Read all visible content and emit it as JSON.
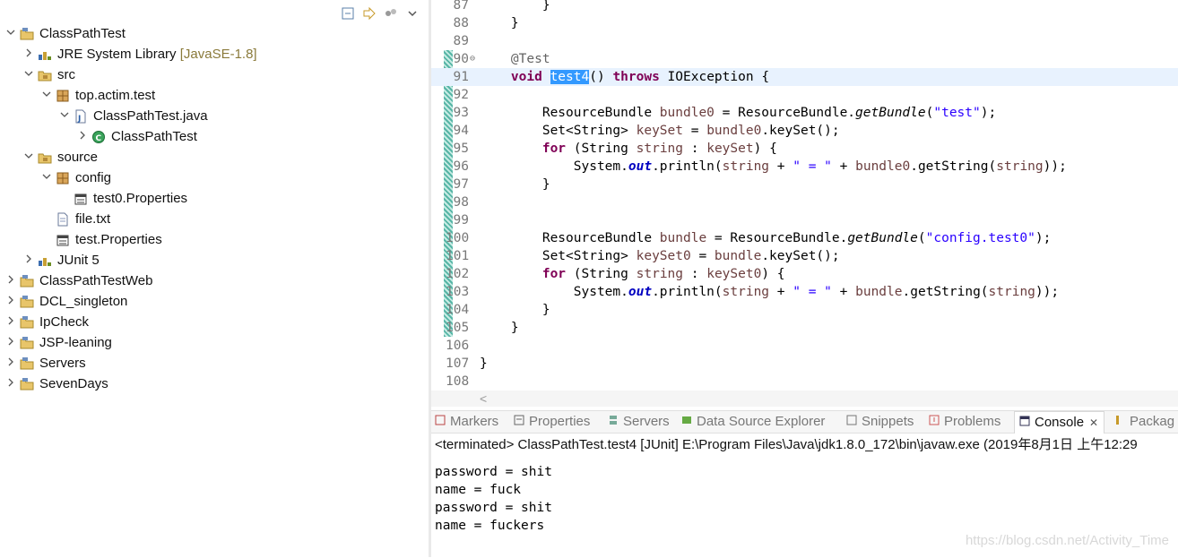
{
  "explorer": {
    "toolbar_icons": [
      "collapse-all-icon",
      "link-with-editor-icon",
      "view-menu-icon",
      "view-menu-chevron-icon"
    ],
    "tree": [
      {
        "label": "ClassPathTest",
        "decor": "",
        "icon": "project-icon",
        "expanded": true
      },
      {
        "label": "JRE System Library",
        "decor": "[JavaSE-1.8]",
        "icon": "library-icon",
        "expanded": false
      },
      {
        "label": "src",
        "decor": "",
        "icon": "source-folder-icon",
        "expanded": true
      },
      {
        "label": "top.actim.test",
        "decor": "",
        "icon": "package-icon",
        "expanded": true
      },
      {
        "label": "ClassPathTest.java",
        "decor": "",
        "icon": "java-file-icon",
        "expanded": true
      },
      {
        "label": "ClassPathTest",
        "decor": "",
        "icon": "class-icon",
        "expanded": false
      },
      {
        "label": "source",
        "decor": "",
        "icon": "source-folder-icon",
        "expanded": true
      },
      {
        "label": "config",
        "decor": "",
        "icon": "package-icon",
        "expanded": true
      },
      {
        "label": "test0.Properties",
        "decor": "",
        "icon": "properties-file-icon",
        "expanded": null
      },
      {
        "label": "file.txt",
        "decor": "",
        "icon": "text-file-icon",
        "expanded": null
      },
      {
        "label": "test.Properties",
        "decor": "",
        "icon": "properties-file-icon",
        "expanded": null
      },
      {
        "label": "JUnit 5",
        "decor": "",
        "icon": "library-icon",
        "expanded": false
      },
      {
        "label": "ClassPathTestWeb",
        "decor": "",
        "icon": "project-icon",
        "expanded": false
      },
      {
        "label": "DCL_singleton",
        "decor": "",
        "icon": "project-icon",
        "expanded": false
      },
      {
        "label": "IpCheck",
        "decor": "",
        "icon": "project-icon",
        "expanded": false
      },
      {
        "label": "JSP-leaning",
        "decor": "",
        "icon": "project-icon",
        "expanded": false
      },
      {
        "label": "Servers",
        "decor": "",
        "icon": "project-icon",
        "expanded": false
      },
      {
        "label": "SevenDays",
        "decor": "",
        "icon": "project-icon",
        "expanded": false
      }
    ]
  },
  "editor": {
    "lines": [
      {
        "no": "87",
        "indent": "        ",
        "parts": [
          {
            "t": "}",
            "c": ""
          }
        ]
      },
      {
        "no": "88",
        "indent": "    ",
        "parts": [
          {
            "t": "}",
            "c": ""
          }
        ]
      },
      {
        "no": "89",
        "indent": "",
        "parts": []
      },
      {
        "no": "90",
        "indent": "    ",
        "fold": "⊖",
        "parts": [
          {
            "t": "@Test",
            "c": "ann"
          }
        ]
      },
      {
        "no": "91",
        "indent": "    ",
        "parts": [
          {
            "t": "void",
            "c": "kw"
          },
          {
            "t": " ",
            "c": ""
          },
          {
            "t": "test4",
            "c": "sel"
          },
          {
            "t": "() ",
            "c": ""
          },
          {
            "t": "throws",
            "c": "kw"
          },
          {
            "t": " IOException {",
            "c": ""
          }
        ]
      },
      {
        "no": "92",
        "indent": "",
        "parts": []
      },
      {
        "no": "93",
        "indent": "        ",
        "parts": [
          {
            "t": "ResourceBundle ",
            "c": ""
          },
          {
            "t": "bundle0",
            "c": "var"
          },
          {
            "t": " = ResourceBundle.",
            "c": ""
          },
          {
            "t": "getBundle",
            "c": "it"
          },
          {
            "t": "(",
            "c": ""
          },
          {
            "t": "\"test\"",
            "c": "str"
          },
          {
            "t": ");",
            "c": ""
          }
        ]
      },
      {
        "no": "94",
        "indent": "        ",
        "parts": [
          {
            "t": "Set<String> ",
            "c": ""
          },
          {
            "t": "keySet",
            "c": "var"
          },
          {
            "t": " = ",
            "c": ""
          },
          {
            "t": "bundle0",
            "c": "var"
          },
          {
            "t": ".keySet();",
            "c": ""
          }
        ]
      },
      {
        "no": "95",
        "indent": "        ",
        "parts": [
          {
            "t": "for",
            "c": "kw"
          },
          {
            "t": " (String ",
            "c": ""
          },
          {
            "t": "string",
            "c": "var"
          },
          {
            "t": " : ",
            "c": ""
          },
          {
            "t": "keySet",
            "c": "var"
          },
          {
            "t": ") {",
            "c": ""
          }
        ]
      },
      {
        "no": "96",
        "indent": "            ",
        "parts": [
          {
            "t": "System.",
            "c": ""
          },
          {
            "t": "out",
            "c": "fld"
          },
          {
            "t": ".println(",
            "c": ""
          },
          {
            "t": "string",
            "c": "var"
          },
          {
            "t": " + ",
            "c": ""
          },
          {
            "t": "\" = \"",
            "c": "str"
          },
          {
            "t": " + ",
            "c": ""
          },
          {
            "t": "bundle0",
            "c": "var"
          },
          {
            "t": ".getString(",
            "c": ""
          },
          {
            "t": "string",
            "c": "var"
          },
          {
            "t": "));",
            "c": ""
          }
        ]
      },
      {
        "no": "97",
        "indent": "        ",
        "parts": [
          {
            "t": "}",
            "c": ""
          }
        ]
      },
      {
        "no": "98",
        "indent": "",
        "parts": []
      },
      {
        "no": "99",
        "indent": "",
        "parts": []
      },
      {
        "no": "100",
        "indent": "        ",
        "parts": [
          {
            "t": "ResourceBundle ",
            "c": ""
          },
          {
            "t": "bundle",
            "c": "var"
          },
          {
            "t": " = ResourceBundle.",
            "c": ""
          },
          {
            "t": "getBundle",
            "c": "it"
          },
          {
            "t": "(",
            "c": ""
          },
          {
            "t": "\"config.test0\"",
            "c": "str"
          },
          {
            "t": ");",
            "c": ""
          }
        ]
      },
      {
        "no": "101",
        "indent": "        ",
        "parts": [
          {
            "t": "Set<String> ",
            "c": ""
          },
          {
            "t": "keySet0",
            "c": "var"
          },
          {
            "t": " = ",
            "c": ""
          },
          {
            "t": "bundle",
            "c": "var"
          },
          {
            "t": ".keySet();",
            "c": ""
          }
        ]
      },
      {
        "no": "102",
        "indent": "        ",
        "parts": [
          {
            "t": "for",
            "c": "kw"
          },
          {
            "t": " (String ",
            "c": ""
          },
          {
            "t": "string",
            "c": "var"
          },
          {
            "t": " : ",
            "c": ""
          },
          {
            "t": "keySet0",
            "c": "var"
          },
          {
            "t": ") {",
            "c": ""
          }
        ]
      },
      {
        "no": "103",
        "indent": "            ",
        "parts": [
          {
            "t": "System.",
            "c": ""
          },
          {
            "t": "out",
            "c": "fld"
          },
          {
            "t": ".println(",
            "c": ""
          },
          {
            "t": "string",
            "c": "var"
          },
          {
            "t": " + ",
            "c": ""
          },
          {
            "t": "\" = \"",
            "c": "str"
          },
          {
            "t": " + ",
            "c": ""
          },
          {
            "t": "bundle",
            "c": "var"
          },
          {
            "t": ".getString(",
            "c": ""
          },
          {
            "t": "string",
            "c": "var"
          },
          {
            "t": "));",
            "c": ""
          }
        ]
      },
      {
        "no": "104",
        "indent": "        ",
        "parts": [
          {
            "t": "}",
            "c": ""
          }
        ]
      },
      {
        "no": "105",
        "indent": "    ",
        "parts": [
          {
            "t": "}",
            "c": ""
          }
        ]
      },
      {
        "no": "106",
        "indent": "",
        "parts": []
      },
      {
        "no": "107",
        "indent": "",
        "parts": [
          {
            "t": "}",
            "c": ""
          }
        ]
      },
      {
        "no": "108",
        "indent": "",
        "parts": []
      }
    ],
    "current_line": "91",
    "scroll_left_arrow": "<"
  },
  "console": {
    "tabs": [
      {
        "label": "Markers",
        "icon": "markers-icon",
        "active": false
      },
      {
        "label": "Properties",
        "icon": "properties-icon",
        "active": false
      },
      {
        "label": "Servers",
        "icon": "servers-icon",
        "active": false
      },
      {
        "label": "Data Source Explorer",
        "icon": "data-source-icon",
        "active": false
      },
      {
        "label": "Snippets",
        "icon": "snippets-icon",
        "active": false
      },
      {
        "label": "Problems",
        "icon": "problems-icon",
        "active": false
      },
      {
        "label": "Console",
        "icon": "console-icon",
        "active": true
      },
      {
        "label": "Packag",
        "icon": "package-explorer-icon",
        "active": false
      }
    ],
    "close_glyph": "✕",
    "header": "<terminated> ClassPathTest.test4 [JUnit] E:\\Program Files\\Java\\jdk1.8.0_172\\bin\\javaw.exe (2019年8月1日 上午12:29",
    "output": [
      "password = shit",
      "name = fuck",
      "password = shit",
      "name = fuckers"
    ]
  },
  "watermark": "https://blog.csdn.net/Activity_Time",
  "colors": {
    "keyword": "#7f0055",
    "string": "#2a00ff",
    "annotation": "#646464",
    "variable": "#6a3e3e",
    "selection": "#3399ff"
  }
}
